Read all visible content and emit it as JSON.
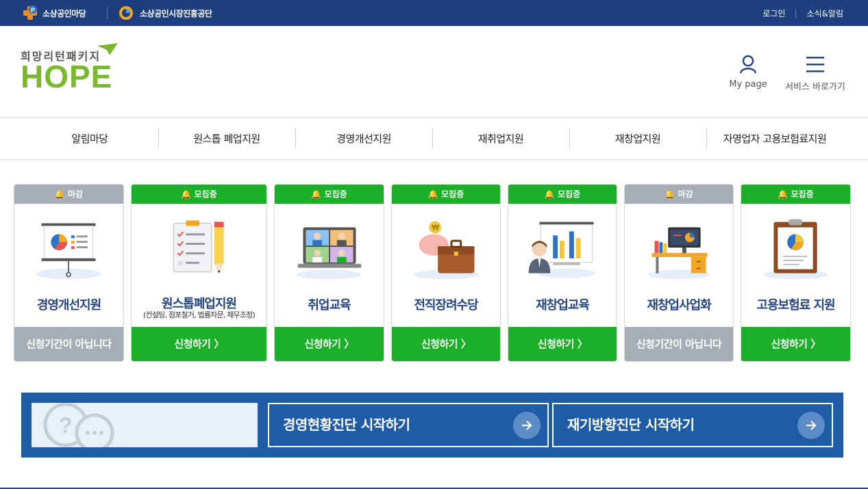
{
  "topbar": {
    "logo1": "소상공인마당",
    "logo2": "소상공인시장진흥공단",
    "login": "로그인",
    "news": "소식&알림"
  },
  "header": {
    "logo_sub": "희망리턴패키지",
    "logo_main": "HOPE",
    "mypage": "My page",
    "menu": "서비스 바로가기"
  },
  "nav": {
    "items": [
      "알림마당",
      "원스톱 폐업지원",
      "경영개선지원",
      "재취업지원",
      "재창업지원",
      "자영업자 고용보험료지원"
    ]
  },
  "cards": [
    {
      "badge": "마감",
      "title": "경영개선지원",
      "subtitle": "",
      "button": "신청기간이 아닙니다",
      "status": "closed"
    },
    {
      "badge": "모집중",
      "title": "원스톱폐업지원",
      "subtitle": "(컨설팅, 점포철거, 법률자문, 채무조정)",
      "button": "신청하기 〉",
      "status": "open"
    },
    {
      "badge": "모집중",
      "title": "취업교육",
      "subtitle": "",
      "button": "신청하기 〉",
      "status": "open"
    },
    {
      "badge": "모집중",
      "title": "전직장려수당",
      "subtitle": "",
      "button": "신청하기 〉",
      "status": "open"
    },
    {
      "badge": "모집중",
      "title": "재창업교육",
      "subtitle": "",
      "button": "신청하기 〉",
      "status": "open"
    },
    {
      "badge": "마감",
      "title": "재창업사업화",
      "subtitle": "",
      "button": "신청기간이 아닙니다",
      "status": "closed"
    },
    {
      "badge": "모집중",
      "title": "고용보험료 지원",
      "subtitle": "",
      "button": "신청하기 〉",
      "status": "open"
    }
  ],
  "banner": {
    "diag1": "경영현황진단 시작하기",
    "diag2": "재기방향진단 시작하기"
  },
  "colors": {
    "brand_navy": "#1d3f7e",
    "open_green": "#1ab028",
    "closed_gray": "#a6adb7",
    "title_blue": "#23447f",
    "banner_blue": "#1f5ca6",
    "hope_green": "#7ab830"
  }
}
